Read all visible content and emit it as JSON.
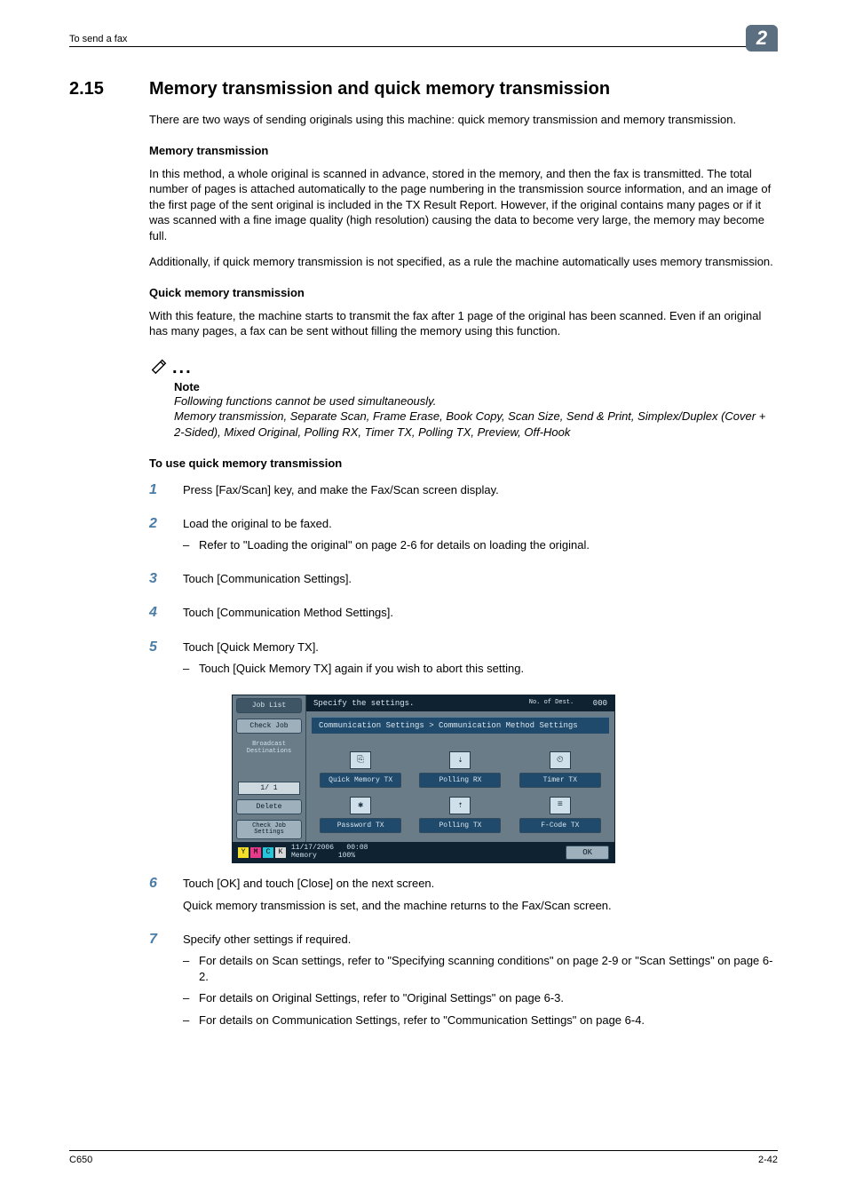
{
  "header": {
    "running_title": "To send a fax",
    "chapter_number": "2"
  },
  "section": {
    "number": "2.15",
    "title": "Memory transmission and quick memory transmission",
    "intro": "There are two ways of sending originals using this machine: quick memory transmission and memory transmission."
  },
  "memory_tx": {
    "heading": "Memory transmission",
    "p1": "In this method, a whole original is scanned in advance, stored in the memory, and then the fax is transmitted. The total number of pages is attached automatically to the page numbering in the transmission source information, and an image of the first page of the sent original is included in the TX Result Report. However, if the original contains many pages or if it was scanned with a fine image quality (high resolution) causing the data to become very large, the memory may become full.",
    "p2": "Additionally, if quick memory transmission is not specified, as a rule the machine automatically uses memory transmission."
  },
  "quick_tx": {
    "heading": "Quick memory transmission",
    "p1": "With this feature, the machine starts to transmit the fax after 1 page of the original has been scanned. Even if an original has many pages, a fax can be sent without filling the memory using this function."
  },
  "note": {
    "label": "Note",
    "line1": "Following functions cannot be used simultaneously.",
    "line2": "Memory transmission, Separate Scan, Frame Erase, Book Copy, Scan Size, Send & Print, Simplex/Duplex (Cover + 2-Sided), Mixed Original, Polling RX, Timer TX, Polling TX, Preview, Off-Hook"
  },
  "procedure": {
    "heading": "To use quick memory transmission",
    "steps": [
      {
        "n": "1",
        "text": "Press [Fax/Scan] key, and make the Fax/Scan screen display."
      },
      {
        "n": "2",
        "text": "Load the original to be faxed.",
        "sub": [
          "Refer to \"Loading the original\" on page 2-6 for details on loading the original."
        ]
      },
      {
        "n": "3",
        "text": "Touch [Communication Settings]."
      },
      {
        "n": "4",
        "text": "Touch [Communication Method Settings]."
      },
      {
        "n": "5",
        "text": "Touch [Quick Memory TX].",
        "sub": [
          "Touch [Quick Memory TX] again if you wish to abort this setting."
        ]
      },
      {
        "n": "6",
        "text": "Touch [OK] and touch [Close] on the next screen.",
        "after": "Quick memory transmission is set, and the machine returns to the Fax/Scan screen."
      },
      {
        "n": "7",
        "text": "Specify other settings if required.",
        "sub": [
          "For details on Scan settings, refer to \"Specifying scanning conditions\" on page 2-9 or \"Scan Settings\" on page 6-2.",
          "For details on Original Settings, refer to \"Original Settings\" on page 6-3.",
          "For details on Communication Settings, refer to \"Communication Settings\" on page 6-4."
        ]
      }
    ]
  },
  "screengrab": {
    "left": {
      "job_list": "Job List",
      "check_job": "Check Job",
      "broadcast": "Broadcast\nDestinations",
      "page": "1/  1",
      "delete": "Delete",
      "check_settings": "Check Job\nSettings"
    },
    "title_row": {
      "prompt": "Specify the settings.",
      "dest_label": "No. of\nDest.",
      "dest_count": "000"
    },
    "breadcrumb": "Communication Settings > Communication Method Settings",
    "options": [
      {
        "label": "Quick Memory TX"
      },
      {
        "label": "Polling RX"
      },
      {
        "label": "Timer TX"
      },
      {
        "label": "Password TX"
      },
      {
        "label": "Polling TX"
      },
      {
        "label": "F-Code TX"
      }
    ],
    "status": {
      "date": "11/17/2006",
      "time": "00:08",
      "mem_label": "Memory",
      "mem_pct": "100%",
      "ok": "OK"
    }
  },
  "footer": {
    "model": "C650",
    "page": "2-42"
  }
}
